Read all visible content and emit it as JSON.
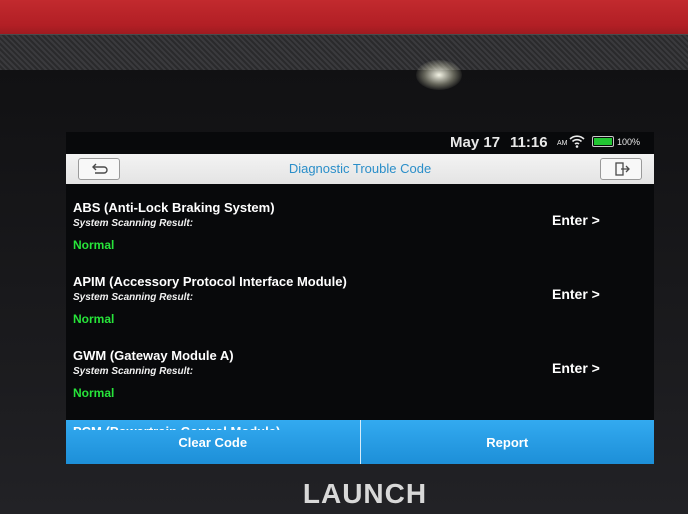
{
  "device": {
    "brand": "LAUNCH"
  },
  "status_bar": {
    "date": "May 17",
    "time": "11:16",
    "ampm": "AM",
    "battery": "100%",
    "battery_level": 1.0,
    "battery_color": "#22c532",
    "wifi_icon": "wifi-icon"
  },
  "header": {
    "title": "Diagnostic Trouble Code",
    "back_icon": "back-arrow-icon",
    "exit_icon": "exit-icon"
  },
  "modules": [
    {
      "name": "ABS (Anti-Lock Braking System)",
      "subtitle": "System Scanning Result:",
      "result": "Normal",
      "action": "Enter >"
    },
    {
      "name": "APIM (Accessory Protocol Interface Module)",
      "subtitle": "System Scanning Result:",
      "result": "Normal",
      "action": "Enter >"
    },
    {
      "name": "GWM (Gateway Module A)",
      "subtitle": "System Scanning Result:",
      "result": "Normal",
      "action": "Enter >"
    },
    {
      "name": "PCM (Powertrain Control Module)"
    }
  ],
  "footer": {
    "clear_label": "Clear Code",
    "report_label": "Report"
  },
  "colors": {
    "accent": "#2a8ec9",
    "button": "#1d8fd8",
    "normal": "#27e43a"
  }
}
